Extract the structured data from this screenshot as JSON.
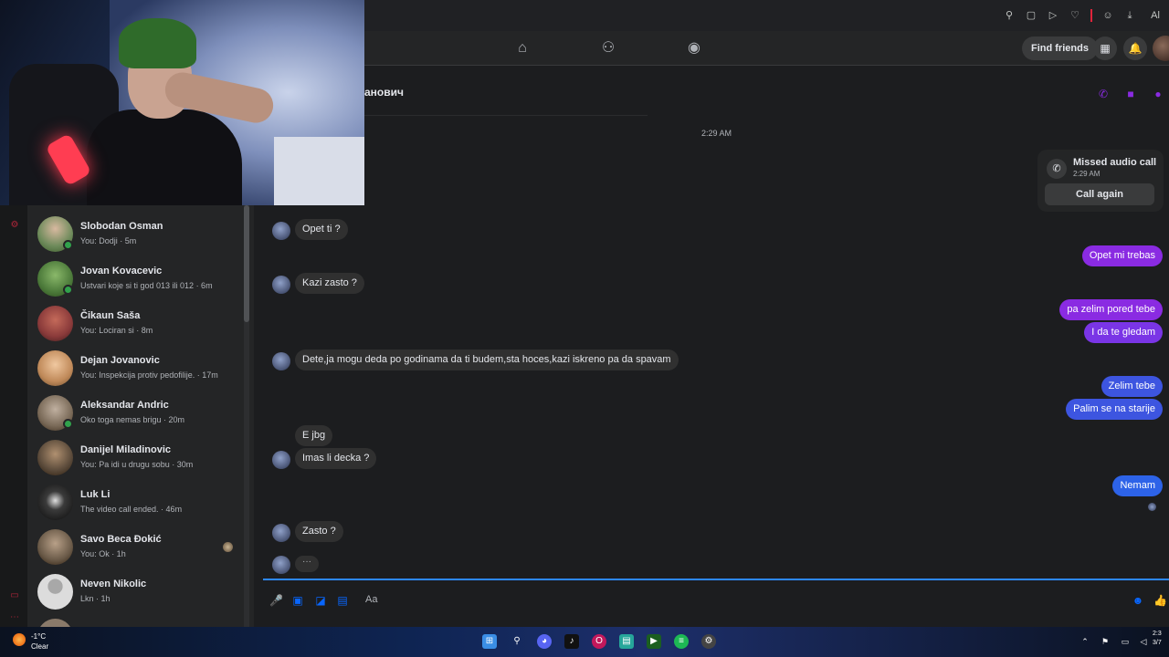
{
  "browser": {
    "icons": [
      "pin-icon",
      "window-icon",
      "play-icon",
      "heart-icon",
      "user-icon",
      "download-icon",
      "extension-icon"
    ],
    "tail_text": "Al"
  },
  "fb_nav": {
    "find_friends_label": "Find friends",
    "icons": [
      "home-icon",
      "friends-icon",
      "groups-icon"
    ]
  },
  "chat_list": [
    {
      "name": "Slobodan Osman",
      "preview": "You: Dodji · 5m",
      "online": true,
      "avatar_color": "#6d8a5a"
    },
    {
      "name": "Jovan Kovacevic",
      "preview": "Ustvari koje si ti god 013 ili 012 · 6m",
      "online": true,
      "avatar_color": "#4c7a3a"
    },
    {
      "name": "Čikaun Saša",
      "preview": "You: Lociran si · 8m",
      "online": false,
      "avatar_color": "#8a3a3a"
    },
    {
      "name": "Dejan Jovanovic",
      "preview": "You: Inspekcija protiv pedofilije. · 17m",
      "online": false,
      "avatar_color": "#c08a5a"
    },
    {
      "name": "Aleksandar Andric",
      "preview": "Oko toga nemas brigu · 20m",
      "online": true,
      "avatar_color": "#7a6a58"
    },
    {
      "name": "Danijel Miladinovic",
      "preview": "You: Pa idi u drugu sobu · 30m",
      "online": false,
      "avatar_color": "#5a4a3a"
    },
    {
      "name": "Luk Li",
      "preview": "The video call ended. · 46m",
      "online": false,
      "avatar_color": "#1a1a1a"
    },
    {
      "name": "Savo Beca Đokić",
      "preview": "You: Ok · 1h",
      "online": false,
      "avatar_color": "#6a5a48"
    },
    {
      "name": "Neven Nikolic",
      "preview": "Lkn · 1h",
      "online": false,
      "avatar_color": "#d0d0d0"
    }
  ],
  "conversation": {
    "title_fragment": "анович",
    "timestamp": "2:29 AM",
    "missed_call": {
      "title": "Missed audio call",
      "time": "2:29 AM",
      "button": "Call again"
    },
    "messages": [
      {
        "dir": "in",
        "text": "Opet ti ?",
        "avatar": true
      },
      {
        "dir": "out",
        "text": "Opet mi trebas",
        "color": "#8a2be2"
      },
      {
        "dir": "in",
        "text": "Kazi zasto ?",
        "avatar": true
      },
      {
        "dir": "out",
        "text": "pa zelim pored tebe",
        "color": "#8a2be2"
      },
      {
        "dir": "out",
        "text": "I da te gledam",
        "color": "#7a35e6"
      },
      {
        "dir": "in",
        "text": "Dete,ja mogu deda po godinama da ti budem,sta hoces,kazi iskreno pa da spavam",
        "avatar": true
      },
      {
        "dir": "out",
        "text": "Zelim tebe",
        "color": "#3d55e0"
      },
      {
        "dir": "out",
        "text": "Palim se na starije",
        "color": "#3d55e0"
      },
      {
        "dir": "in",
        "text": "E jbg",
        "avatar": false
      },
      {
        "dir": "in",
        "text": "Imas li decka ?",
        "avatar": true
      },
      {
        "dir": "out",
        "text": "Nemam",
        "color": "#2d63e8"
      },
      {
        "dir": "in",
        "text": "Zasto ?",
        "avatar": true
      }
    ],
    "typing_indicator": "···",
    "composer_placeholder": "Aa"
  },
  "taskbar": {
    "temperature": "-1°C",
    "condition": "Clear",
    "clock_time": "2:3",
    "clock_date": "3/7"
  }
}
